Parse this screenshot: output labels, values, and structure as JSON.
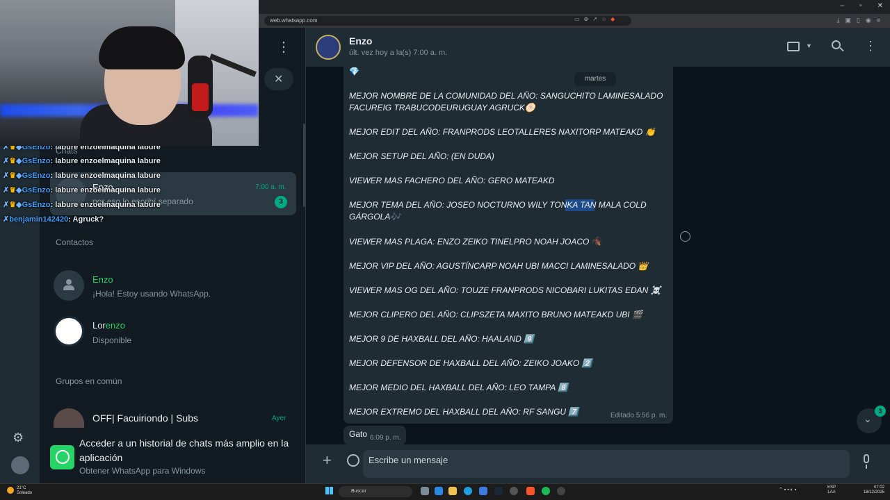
{
  "browser": {
    "url": "web.whatsapp.com",
    "window_controls": [
      "–",
      "▫",
      "✕"
    ]
  },
  "sidebar": {
    "section_chats": "Chats",
    "pinned_chat": {
      "name": "Enzo",
      "preview": "por eso lo escribí separado",
      "time": "7:00 a. m.",
      "unread": "3"
    },
    "section_contacts": "Contactos",
    "contacts": [
      {
        "name": "Enzo",
        "status": "¡Hola! Estoy usando WhatsApp."
      },
      {
        "name_prefix": "Lor",
        "name_highlight": "enzo",
        "status": "Disponible"
      }
    ],
    "section_groups": "Grupos en común",
    "group": {
      "name": "OFF| Facuiriondo | Subs",
      "time": "Ayer"
    },
    "promo": {
      "title": "Acceder a un historial de chats más amplio en la aplicación",
      "subtitle": "Obtener WhatsApp para Windows"
    }
  },
  "twitch_chat": [
    {
      "user": "GsEnzo",
      "text": "labure enzoelmaquina labure"
    },
    {
      "user": "GsEnzo",
      "text": "labure enzoelmaquina labure"
    },
    {
      "user": "GsEnzo",
      "text": "labure enzoelmaquina labure"
    },
    {
      "user": "GsEnzo",
      "text": "labure enzoelmaquina labure"
    },
    {
      "user": "GsEnzo",
      "text": "labure enzoelmaquina labure"
    },
    {
      "user": "benjamin142420",
      "text": "Agruck?"
    }
  ],
  "chat": {
    "contact_name": "Enzo",
    "last_seen": "últ. vez hoy a la(s) 7:00 a. m.",
    "date_chip": "martes",
    "message_lines": [
      "💎",
      "MEJOR NOMBRE DE LA COMUNIDAD DEL AÑO: SANGUCHITO LAMINESALADO",
      "FACUREIG TRABUCODEURUGUAY AGRUCK🫓",
      "MEJOR EDIT DEL AÑO: FRANPRODS LEOTALLERES NAXITORP MATEAKD 👏",
      "MEJOR SETUP DEL AÑO: (EN DUDA)",
      "VIEWER MAS FACHERO DEL AÑO: GERO MATEAKD",
      "MEJOR TEMA DEL AÑO: JOSEO NOCTURNO WILY TONKA TAN MALA COLD",
      "GÁRGOLA🎶",
      "VIEWER MAS PLAGA: ENZO ZEIKO TINELPRO NOAH JOACO 🪳",
      "MEJOR VIP DEL AÑO: AGUSTÍNCARP NOAH UBI MACCI LAMINESALADO 👑",
      "VIEWER MAS OG DEL AÑO: TOUZE FRANPRODS NICOBARI LUKITAS EDAN ☠️",
      "MEJOR CLIPERO DEL AÑO: CLIPSZETA MAXITO BRUNO MATEAKD UBI 🎬",
      "MEJOR 9 DE HAXBALL DEL AÑO: HAALAND 9️⃣",
      "MEJOR DEFENSOR DE HAXBALL DEL AÑO: ZEIKO JOAKO 2️⃣",
      "MEJOR MEDIO DEL HAXBALL DEL AÑO: LEO TAMPA 8️⃣",
      "MEJOR EXTREMO DEL HAXBALL DEL AÑO: RF SANGU 7️⃣"
    ],
    "edited_label": "Editado 5:56 p. m.",
    "second_message": {
      "text": "Gato",
      "time": "6:09 p. m."
    },
    "scroll_badge": "3",
    "composer_placeholder": "Escribe un mensaje"
  },
  "taskbar": {
    "weather_temp": "21°C",
    "weather_desc": "Soleado",
    "search_label": "Buscar",
    "lang_1": "ESP",
    "lang_2": "LAA",
    "time": "07:02",
    "date": "18/12/2025"
  },
  "colors": {
    "accent": "#00a884",
    "panel": "#202c33",
    "background": "#111b21"
  }
}
